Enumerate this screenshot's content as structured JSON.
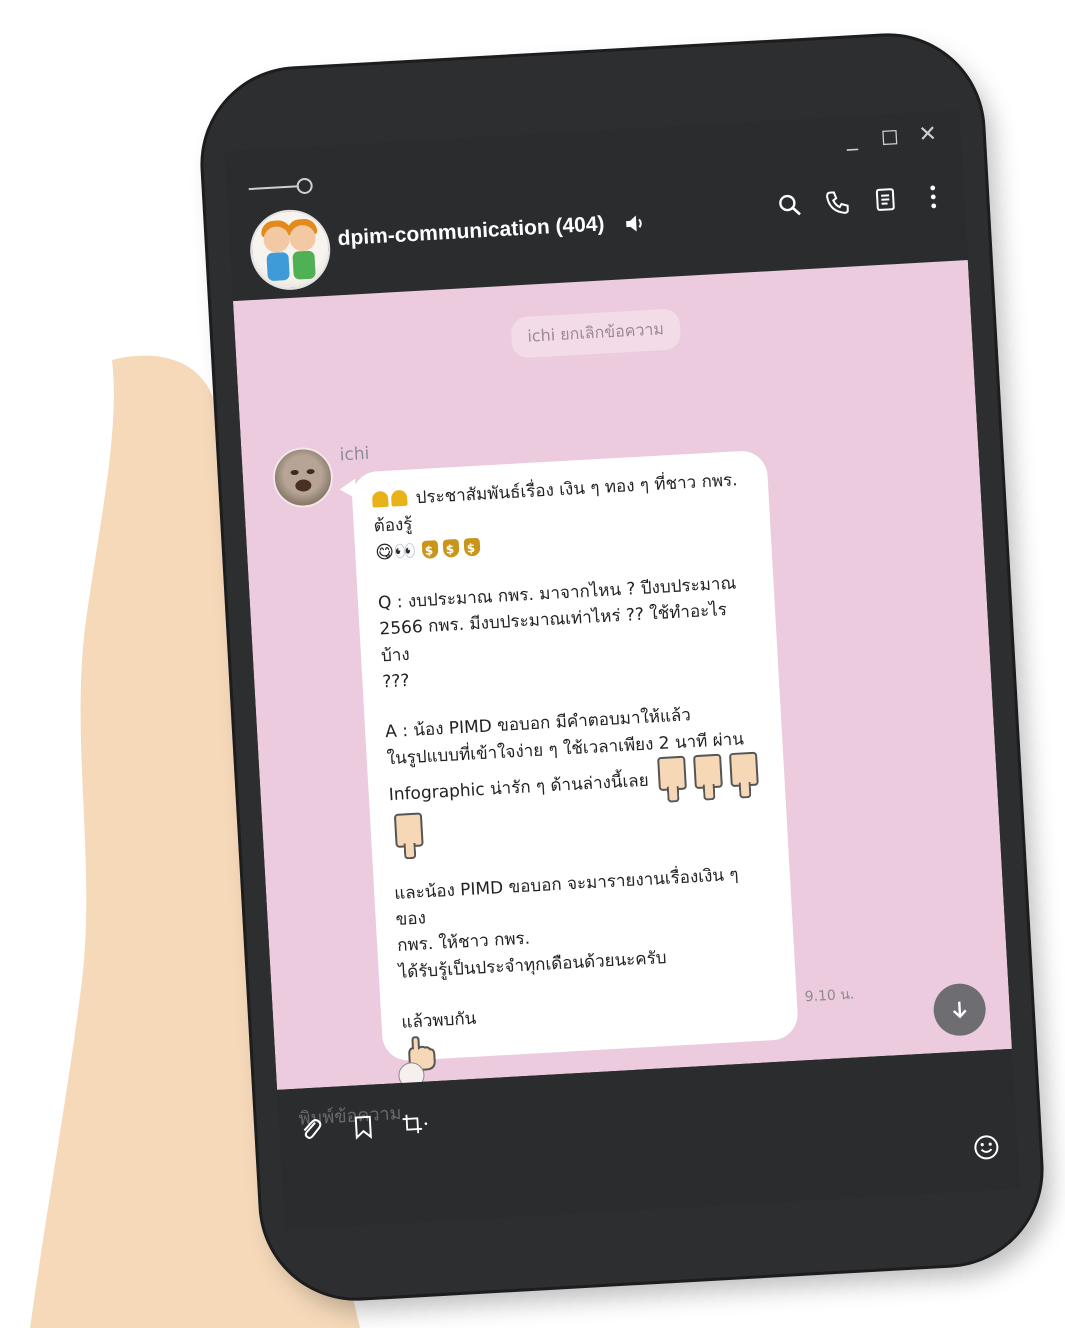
{
  "window_controls": {
    "minimize": "_",
    "maximize": "◻",
    "close": "✕"
  },
  "chat": {
    "title": "dpim-communication (404)",
    "system_notice": "ichi ยกเลิกข้อความ",
    "sender_name": "ichi",
    "message": {
      "line1": "ประชาสัมพันธ์เรื่อง เงิน ๆ ทอง ๆ ที่ชาว กพร.",
      "line2": "ต้องรู้",
      "line3_emoji": "😋👀",
      "q1": "Q : งบประมาณ กพร. มาจากไหน ?  ปีงบประมาณ",
      "q2": "2566 กพร. มีงบประมาณเท่าไหร่ ??  ใช้ทำอะไรบ้าง",
      "q3": "???",
      "a1": "A : น้อง PIMD ขอบอก  มีคำตอบมาให้แล้ว",
      "a2": "ในรูปแบบที่เข้าใจง่าย ๆ ใช้เวลาเพียง 2 นาที ผ่าน",
      "a3": "Infographic น่ารัก ๆ ด้านล่างนี้เลย",
      "b1": "และน้อง PIMD ขอบอก จะมารายงานเรื่องเงิน ๆ ของ",
      "b2": "กพร. ให้ชาว กพร.",
      "b3": "ได้รับรู้เป็นประจำทุกเดือนด้วยนะครับ",
      "c1": "แล้วพบกัน",
      "timestamp": "9.10 น."
    }
  },
  "composer": {
    "placeholder": "พิมพ์ข้อความ"
  },
  "colors": {
    "chat_background": "#ebcbdd",
    "frame": "#2d2e30",
    "hand": "#f5d9b9"
  }
}
